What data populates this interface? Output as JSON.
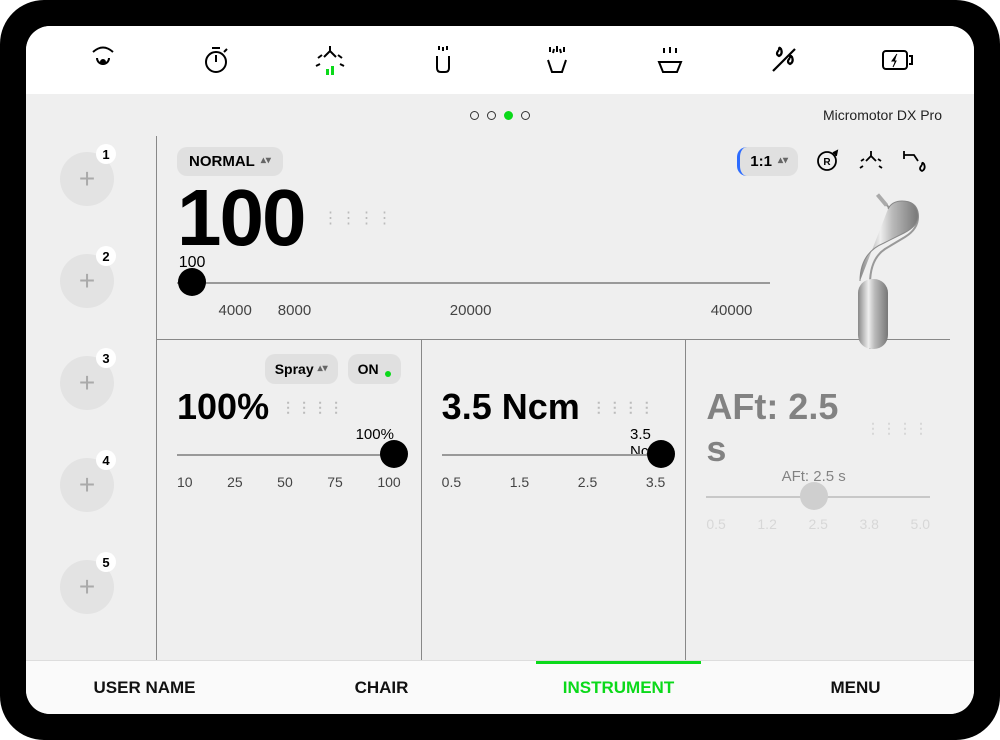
{
  "device_title": "Micromotor DX Pro",
  "topbar_icons": [
    "suction-icon",
    "timer-icon",
    "lamp-icon",
    "cup-icon",
    "spray-icon",
    "bowl-rinse-icon",
    "water-off-icon",
    "power-icon"
  ],
  "page_dots": {
    "count": 4,
    "active_index": 2
  },
  "slots": [
    {
      "num": "1"
    },
    {
      "num": "2"
    },
    {
      "num": "3"
    },
    {
      "num": "4"
    },
    {
      "num": "5"
    }
  ],
  "speed": {
    "mode_label": "NORMAL",
    "ratio_label": "1:1",
    "value": "100",
    "slider_label": "100",
    "ticks": [
      "4000",
      "8000",
      "20000",
      "40000"
    ],
    "thumb_pct": 2
  },
  "spray": {
    "select_label": "Spray",
    "toggle_label": "ON",
    "value": "100%",
    "slider_label": "100%",
    "ticks": [
      "10",
      "25",
      "50",
      "75",
      "100"
    ],
    "thumb_pct": 97
  },
  "torque": {
    "value": "3.5 Ncm",
    "slider_label": "3.5 Ncm",
    "ticks": [
      "0.5",
      "1.5",
      "2.5",
      "3.5"
    ],
    "thumb_pct": 98
  },
  "aft": {
    "value": "AFt: 2.5 s",
    "slider_label": "AFt: 2.5 s",
    "ticks": [
      "0.5",
      "1.2",
      "2.5",
      "3.8",
      "5.0"
    ],
    "thumb_pct": 48
  },
  "tabs": {
    "user": "USER NAME",
    "chair": "CHAIR",
    "instrument": "INSTRUMENT",
    "menu": "MENU",
    "active": "instrument"
  }
}
